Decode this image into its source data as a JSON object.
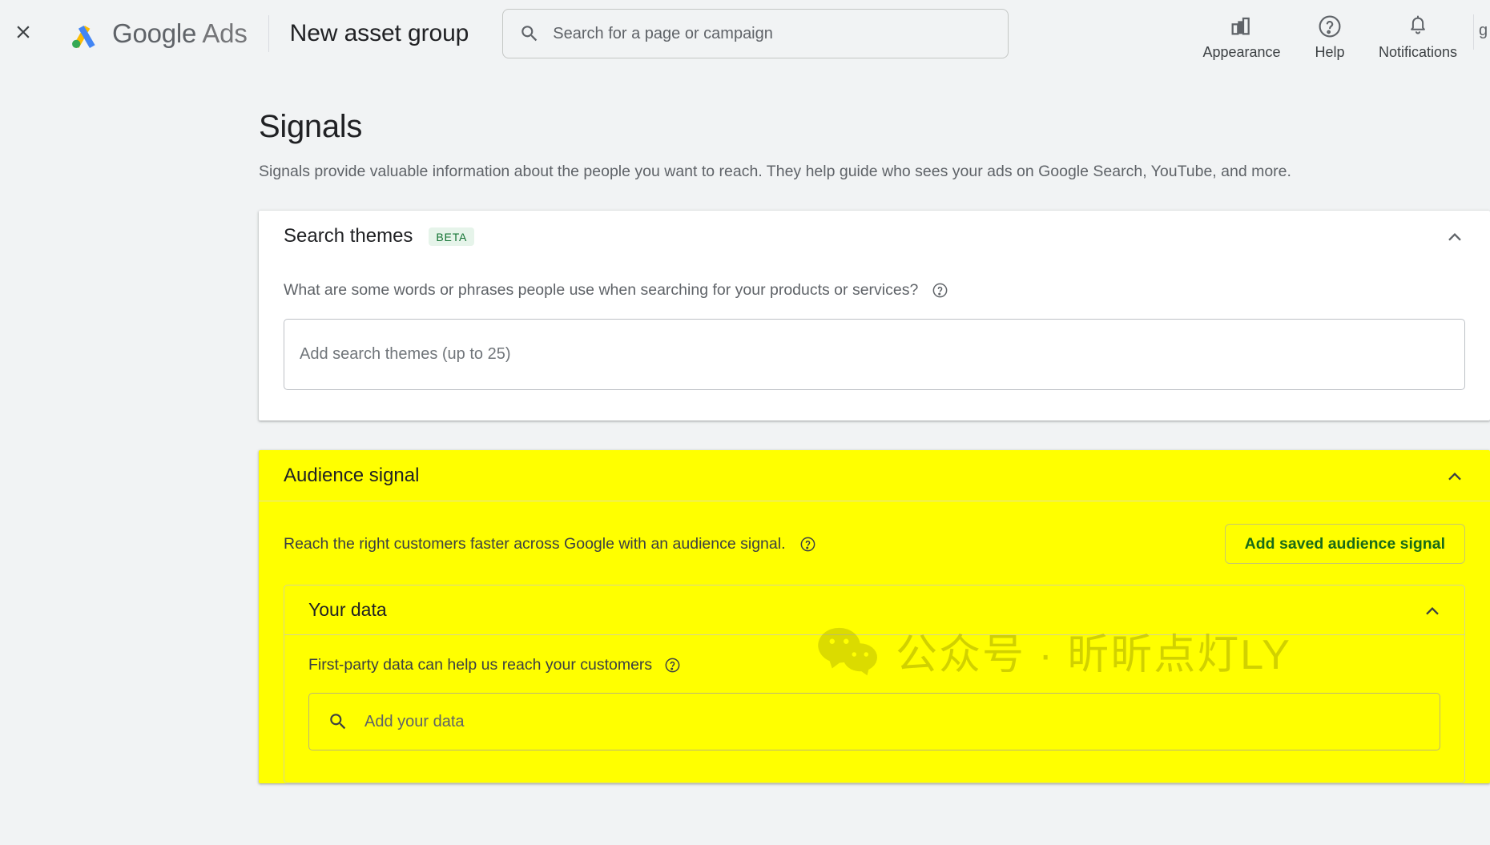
{
  "topbar": {
    "close_icon": "close-icon",
    "brand_google": "Google",
    "brand_ads": "Ads",
    "page_title": "New asset group",
    "search": {
      "placeholder": "Search for a page or campaign",
      "icon": "search-icon"
    },
    "appearance_label": "Appearance",
    "help_label": "Help",
    "notifications_label": "Notifications",
    "edge_text": "g"
  },
  "page": {
    "heading": "Signals",
    "description": "Signals provide valuable information about the people you want to reach. They help guide who sees your ads on Google Search, YouTube, and more."
  },
  "search_themes": {
    "title": "Search themes",
    "badge": "BETA",
    "question": "What are some words or phrases people use when searching for your products or services?",
    "input_placeholder": "Add search themes (up to 25)",
    "collapse_icon": "chevron-up-icon",
    "help_icon": "help-circle-icon"
  },
  "audience_signal": {
    "title": "Audience signal",
    "collapse_icon": "chevron-up-icon",
    "reach_text": "Reach the right customers faster across Google with an audience signal.",
    "help_icon": "help-circle-icon",
    "add_button": "Add saved audience signal",
    "your_data": {
      "title": "Your data",
      "collapse_icon": "chevron-up-icon",
      "description": "First-party data can help us reach your customers",
      "help_icon": "help-circle-icon",
      "search_placeholder": "Add your data",
      "search_icon": "search-icon"
    }
  },
  "watermark": {
    "text": "公众号 · 昕昕点灯LY",
    "icon": "wechat-icon"
  },
  "colors": {
    "highlight_yellow": "#ffff00",
    "beta_bg": "#e6f4ea",
    "beta_text": "#137333",
    "link_green": "#186a18",
    "page_bg": "#f1f3f4"
  }
}
